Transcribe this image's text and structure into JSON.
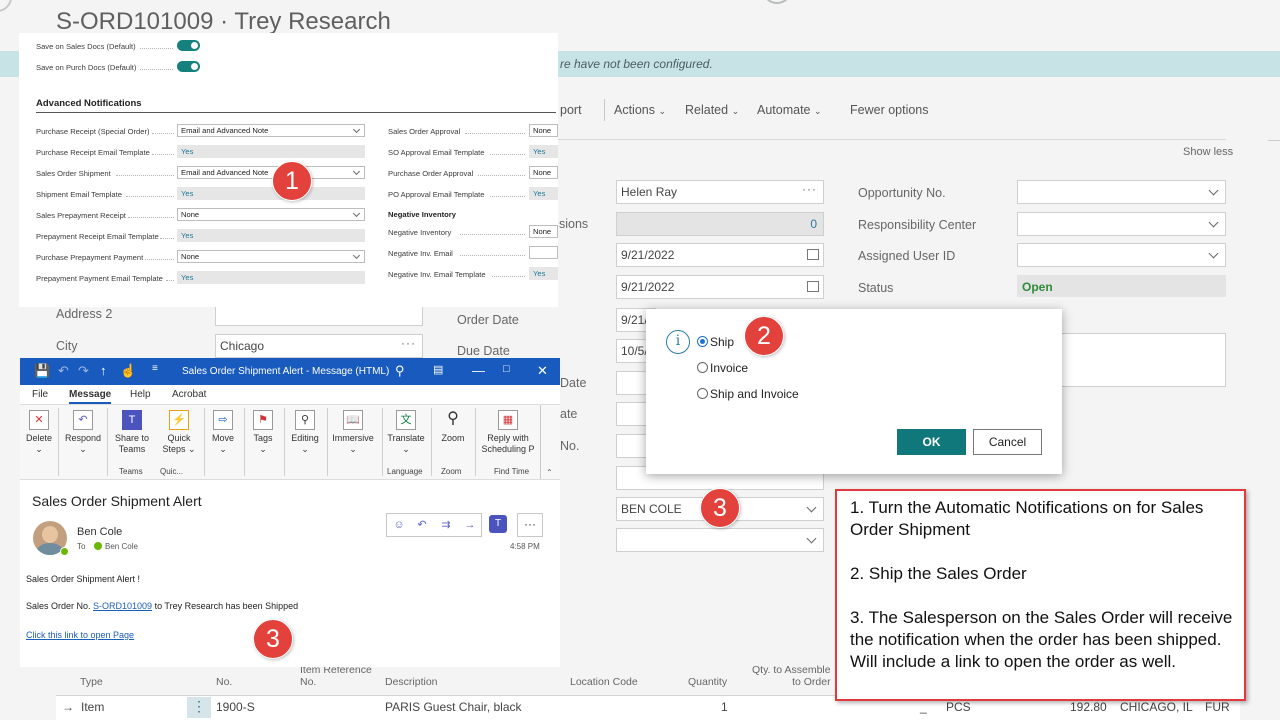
{
  "background_page": {
    "title": "S-ORD101009 · Trey Research",
    "banner_text": "re have not been configured.",
    "menu": {
      "report_partial": "port",
      "actions": "Actions",
      "related": "Related",
      "automate": "Automate",
      "fewer_options": "Fewer options"
    },
    "show_less": "Show less",
    "labels": {
      "extensions_partial": "sions",
      "address2": "Address 2",
      "city": "City",
      "order_date": "Order Date",
      "due_date": "Due Date",
      "date_partial": "Date",
      "ate_partial": "ate",
      "no_partial": "No.",
      "opportunity_no": "Opportunity No.",
      "responsibility_center": "Responsibility Center",
      "assigned_user_id": "Assigned User ID",
      "status": "Status"
    },
    "values": {
      "contact": "Helen Ray",
      "count": "0",
      "date1": "9/21/2022",
      "date2": "9/21/2022",
      "order_date": "9/21/",
      "due_date": "10/5/",
      "city": "Chicago",
      "salesperson": "BEN COLE",
      "status": "Open"
    },
    "lines": {
      "headers": {
        "type": "Type",
        "no": "No.",
        "item_ref_1": "Item Reference",
        "item_ref_2": "No.",
        "description": "Description",
        "location_code": "Location Code",
        "quantity": "Quantity",
        "qty_assemble_1": "Qty. to Assemble",
        "qty_assemble_2": "to Order"
      },
      "row": {
        "arrow": "→",
        "type": "Item",
        "no": "1900-S",
        "description": "PARIS Guest Chair, black",
        "quantity": "1",
        "underscore": "_",
        "uom": "PCS",
        "price": "192.80",
        "location": "CHICAGO, IL",
        "currency": "FUR"
      }
    }
  },
  "panel1": {
    "toggles": [
      {
        "label": "Save on Sales Docs (Default)",
        "on": true
      },
      {
        "label": "Save on Purch Docs (Default)",
        "on": true
      }
    ],
    "heading": "Advanced Notifications",
    "left_rows": [
      {
        "label": "Purchase Receipt (Special Order)",
        "value": "Email and Advanced Note",
        "kind": "select"
      },
      {
        "label": "Purchase Receipt Email Template",
        "value": "Yes",
        "kind": "readonly"
      },
      {
        "label": "Sales Order Shipment",
        "value": "Email and Advanced Note",
        "kind": "select"
      },
      {
        "label": "Shipment Email Template",
        "value": "Yes",
        "kind": "readonly"
      },
      {
        "label": "Sales Prepayment Receipt",
        "value": "None",
        "kind": "select"
      },
      {
        "label": "Prepayment Receipt Email Template",
        "value": "Yes",
        "kind": "readonly"
      },
      {
        "label": "Purchase Prepayment Payment",
        "value": "None",
        "kind": "select"
      },
      {
        "label": "Prepayment Payment Email Template",
        "value": "Yes",
        "kind": "readonly"
      }
    ],
    "right_rows": [
      {
        "label": "Sales Order Approval",
        "value": "None",
        "kind": "select"
      },
      {
        "label": "SO Approval Email Template",
        "value": "Yes",
        "kind": "readonly"
      },
      {
        "label": "Purchase Order Approval",
        "value": "None",
        "kind": "select"
      },
      {
        "label": "PO Approval Email Template",
        "value": "Yes",
        "kind": "readonly"
      },
      {
        "label": "Negative Inventory",
        "value": "",
        "kind": "subheading"
      },
      {
        "label": "Negative Inventory",
        "value": "None",
        "kind": "select"
      },
      {
        "label": "Negative Inv. Email",
        "value": "",
        "kind": "input"
      },
      {
        "label": "Negative Inv. Email Template",
        "value": "Yes",
        "kind": "readonly"
      }
    ]
  },
  "badges": {
    "one": "1",
    "two": "2",
    "three": "3"
  },
  "ship_dialog": {
    "options": [
      {
        "label": "Ship",
        "selected": true
      },
      {
        "label": "Invoice",
        "selected": false
      },
      {
        "label": "Ship and Invoice",
        "selected": false
      }
    ],
    "ok_label": "OK",
    "cancel_label": "Cancel"
  },
  "outlook": {
    "window_title": "Sales Order Shipment Alert  -  Message (HTML)",
    "menu": {
      "file": "File",
      "message": "Message",
      "help": "Help",
      "acrobat": "Acrobat"
    },
    "ribbon": {
      "delete": "Delete",
      "respond": "Respond",
      "share_teams_1": "Share to",
      "share_teams_2": "Teams",
      "quick_steps_1": "Quick",
      "quick_steps_2": "Steps",
      "move": "Move",
      "tags": "Tags",
      "editing": "Editing",
      "immersive": "Immersive",
      "translate": "Translate",
      "zoom": "Zoom",
      "reply_sched_1": "Reply with",
      "reply_sched_2": "Scheduling P",
      "group_teams": "Teams",
      "group_quick": "Quic...",
      "group_language": "Language",
      "group_zoom": "Zoom",
      "group_find_time": "Find Time"
    },
    "subject": "Sales Order Shipment Alert",
    "from": "Ben Cole",
    "to_label": "To",
    "to_name": "Ben Cole",
    "time": "4:58 PM",
    "body_line1": "Sales Order Shipment Alert !",
    "body_line2_prefix": "Sales Order No. ",
    "body_order_no": "S-ORD101009",
    "body_line2_suffix": " to Trey Research has been Shipped",
    "body_link": "Click this link to open Page"
  },
  "instructions": {
    "step1": "1. Turn the Automatic Notifications on for Sales Order Shipment",
    "step2": "2. Ship the Sales Order",
    "step3": "3. The Salesperson on the Sales Order will receive the notification when the order has been shipped. Will include a link to open the order as well."
  },
  "colors": {
    "accent_teal": "#10787a",
    "badge_red": "#e3413c",
    "outlook_blue": "#185abd",
    "notes_border": "#e0393e"
  }
}
